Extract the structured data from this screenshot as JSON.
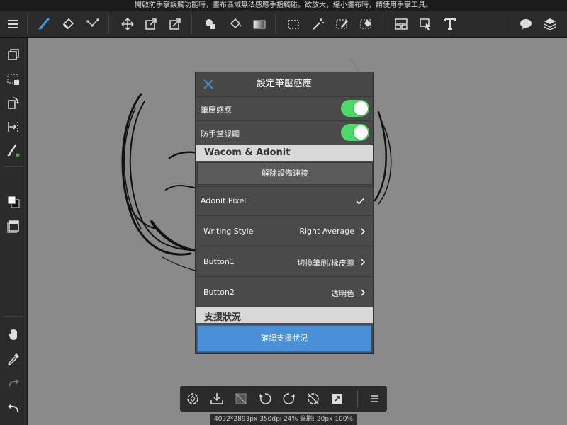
{
  "status_hint": "開啟防手掌誤觸功能時，畫布區域無法感應手指觸碰。欲放大，縮小畫布時，請使用手掌工具。",
  "colors": {
    "toggle_on": "#4cd964",
    "accent_blue": "#4a90d9",
    "dot_green": "#3bb54a",
    "selected_tool": "#3aa0e8"
  },
  "toolbar": {
    "icons": [
      "menu-icon",
      "brush-icon",
      "eraser-icon",
      "vector-icon",
      "move-icon",
      "transform-icon",
      "transform-corner-icon",
      "fill-shape-icon",
      "bucket-icon",
      "gradient-icon",
      "selection-rect-icon",
      "magic-wand-icon",
      "select-pen-icon",
      "select-eraser-icon",
      "layout-icon",
      "select-arrow-icon",
      "text-icon",
      "comment-icon",
      "layers-icon"
    ]
  },
  "dialog": {
    "title": "設定筆壓感應",
    "rows": {
      "pressure_label": "筆壓感應",
      "palm_label": "防手掌誤觸"
    },
    "section_wacom": "Wacom & Adonit",
    "disconnect_label": "解除設備連接",
    "device": "Adonit Pixel",
    "settings": [
      {
        "label": "Writing Style",
        "value": "Right Average"
      },
      {
        "label": "Button1",
        "value": "切換筆刷/橡皮擦"
      },
      {
        "label": "Button2",
        "value": "透明色"
      }
    ],
    "section_support": "支援狀況",
    "confirm_label": "確認支援狀況"
  },
  "footer_info": "4092*2893px 350dpi 24% 筆刷: 20px 100%"
}
